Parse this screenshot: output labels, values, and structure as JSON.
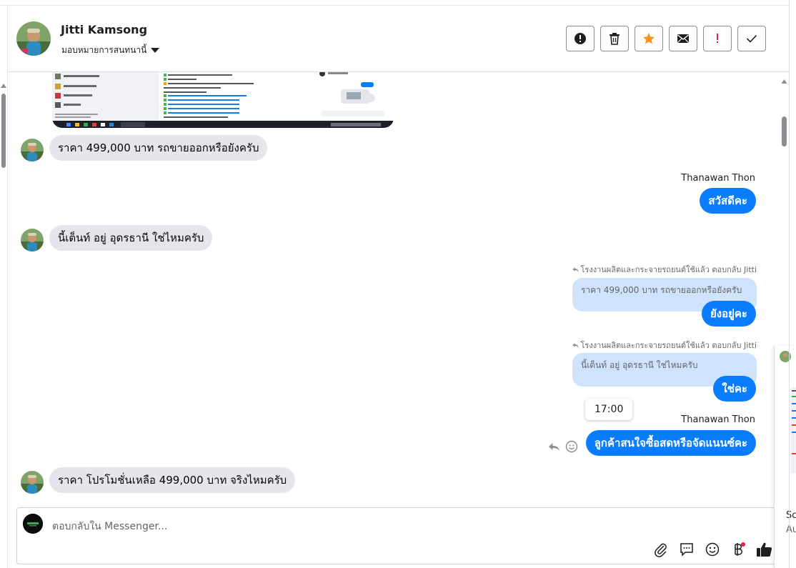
{
  "header": {
    "name": "Jitti Kamsong",
    "assign_label": "มอบหมายการสนทนานี้",
    "actions": [
      {
        "name": "report-button",
        "icon": "exclamation-circle-icon"
      },
      {
        "name": "delete-button",
        "icon": "trash-icon"
      },
      {
        "name": "star-button",
        "icon": "star-icon"
      },
      {
        "name": "mark-unread-button",
        "icon": "envelope-icon"
      },
      {
        "name": "spam-button",
        "icon": "exclamation-icon"
      },
      {
        "name": "done-button",
        "icon": "checkmark-icon"
      }
    ]
  },
  "messages": [
    {
      "type": "in",
      "text": "ราคา 499,000 บาท รถขายออกหรือยังครับ"
    },
    {
      "type": "sender",
      "text": "Thanawan Thon"
    },
    {
      "type": "out",
      "text": "สวัสดีคะ"
    },
    {
      "type": "in",
      "text": "นี้เต็นท์ อยู่ อุดรธานี ใช่ไหมครับ"
    },
    {
      "type": "reply_header",
      "text": "โรงงานผลิตและกระจายรถยนต์ใช้แล้ว ตอบกลับ Jitti"
    },
    {
      "type": "quote",
      "text": "ราคา 499,000 บาท รถขายออกหรือยังครับ"
    },
    {
      "type": "out",
      "text": "ยังอยู่คะ"
    },
    {
      "type": "reply_header",
      "text": "โรงงานผลิตและกระจายรถยนต์ใช้แล้ว ตอบกลับ Jitti"
    },
    {
      "type": "quote",
      "text": "นี้เต็นท์ อยู่ อุดรธานี ใช่ไหมครับ"
    },
    {
      "type": "out",
      "text": "ใช่คะ"
    },
    {
      "type": "tooltip",
      "text": "17:00"
    },
    {
      "type": "sender",
      "text": "Thanawan Thon"
    },
    {
      "type": "out",
      "text": "ลูกค้าสนใจซื้อสดหรือจัดแนนซ์คะ"
    },
    {
      "type": "in",
      "text": "ราคา โปรโมชั่นเหลือ 499,000 บาท จริงไหมครับ"
    }
  ],
  "composer": {
    "placeholder": "ตอบกลับใน Messenger...",
    "tools": [
      "paperclip-icon",
      "saved-reply-icon",
      "emoji-icon",
      "baht-icon",
      "thumbs-up-icon"
    ]
  },
  "side_panel": {
    "line1": "Sc",
    "line2": "Au"
  },
  "colors": {
    "outgoing_bubble": "#0a7cff",
    "incoming_bubble": "#e4e6eb",
    "quote_bubble": "#cfe3fd",
    "star": "#f7931e",
    "spam": "#e41e3f"
  }
}
